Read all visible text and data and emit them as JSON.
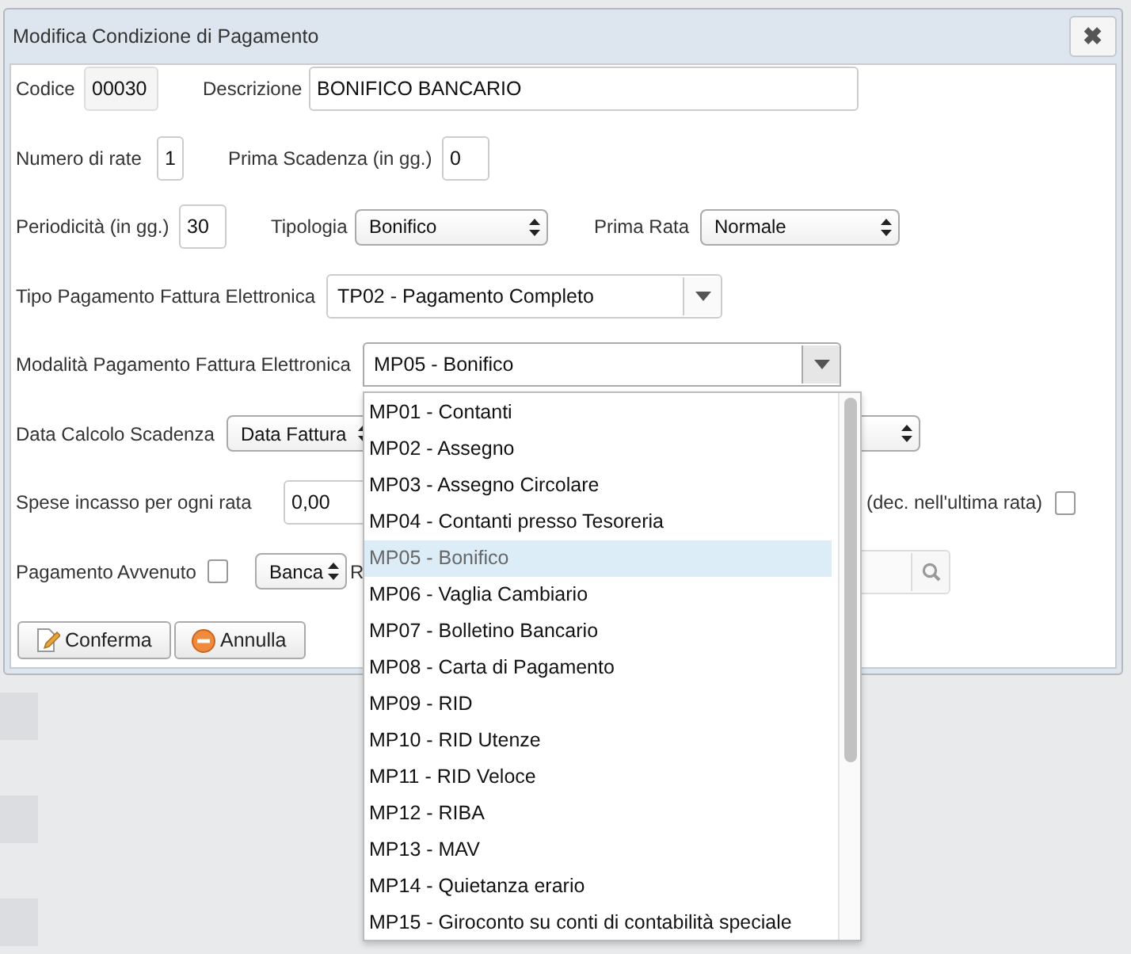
{
  "dialog": {
    "title": "Modifica Condizione di Pagamento",
    "close": "✖"
  },
  "rows": [
    [
      {
        "kind": "label",
        "text": "Codice"
      },
      {
        "kind": "readonly-input",
        "value": "00030"
      },
      {
        "kind": "label",
        "text": "Descrizione"
      },
      {
        "kind": "input",
        "value": "BONIFICO BANCARIO"
      }
    ],
    [
      {
        "kind": "label",
        "text": "Numero di rate"
      },
      {
        "kind": "input",
        "value": "1"
      },
      {
        "kind": "label",
        "text": "Prima Scadenza (in gg.)"
      },
      {
        "kind": "input",
        "value": "0"
      }
    ],
    [
      {
        "kind": "label",
        "text": "Periodicità (in gg.)"
      },
      {
        "kind": "input",
        "value": "30"
      },
      {
        "kind": "label",
        "text": "Tipologia"
      },
      {
        "kind": "select",
        "value": "Bonifico"
      },
      {
        "kind": "label",
        "text": "Prima Rata"
      },
      {
        "kind": "select",
        "value": "Normale"
      }
    ],
    [
      {
        "kind": "label",
        "text": "Tipo Pagamento Fattura Elettronica"
      },
      {
        "kind": "combo",
        "value": "TP02 - Pagamento Completo",
        "expanded": false
      }
    ],
    [
      {
        "kind": "label",
        "text": "Modalità Pagamento Fattura Elettronica"
      },
      {
        "kind": "combo",
        "value": "MP05 - Bonifico",
        "expanded": true
      }
    ],
    [
      {
        "kind": "label",
        "text": "Data Calcolo Scadenza"
      },
      {
        "kind": "select",
        "value": "Data Fattura"
      },
      {
        "kind": "select"
      }
    ],
    [
      {
        "kind": "label",
        "text": "Spese incasso per ogni rata"
      },
      {
        "kind": "input",
        "value": "0,00"
      },
      {
        "kind": "label",
        "text": "(dec. nell'ultima rata)"
      },
      {
        "kind": "checkbox",
        "checked": false
      }
    ],
    [
      {
        "kind": "label",
        "text": "Pagamento Avvenuto"
      },
      {
        "kind": "checkbox",
        "checked": false
      },
      {
        "kind": "select",
        "value": "Banca"
      },
      {
        "kind": "label",
        "text": "R"
      },
      {
        "kind": "search-field"
      }
    ],
    [
      {
        "kind": "button",
        "text": "Conferma"
      },
      {
        "kind": "button",
        "text": "Annulla"
      }
    ]
  ],
  "dropdown": {
    "items": [
      {
        "text": "MP01 - Contanti",
        "selected": false
      },
      {
        "text": "MP02 - Assegno",
        "selected": false
      },
      {
        "text": "MP03 - Assegno Circolare",
        "selected": false
      },
      {
        "text": "MP04 - Contanti presso Tesoreria",
        "selected": false
      },
      {
        "text": "MP05 - Bonifico",
        "selected": true
      },
      {
        "text": "MP06 - Vaglia Cambiario",
        "selected": false
      },
      {
        "text": "MP07 - Bolletino Bancario",
        "selected": false
      },
      {
        "text": "MP08 - Carta di Pagamento",
        "selected": false
      },
      {
        "text": "MP09 - RID",
        "selected": false
      },
      {
        "text": "MP10 - RID Utenze",
        "selected": false
      },
      {
        "text": "MP11 - RID Veloce",
        "selected": false
      },
      {
        "text": "MP12 - RIBA",
        "selected": false
      },
      {
        "text": "MP13 - MAV",
        "selected": false
      },
      {
        "text": "MP14 - Quietanza erario",
        "selected": false
      },
      {
        "text": "MP15 - Giroconto su conti di contabilità speciale",
        "selected": false
      }
    ]
  }
}
